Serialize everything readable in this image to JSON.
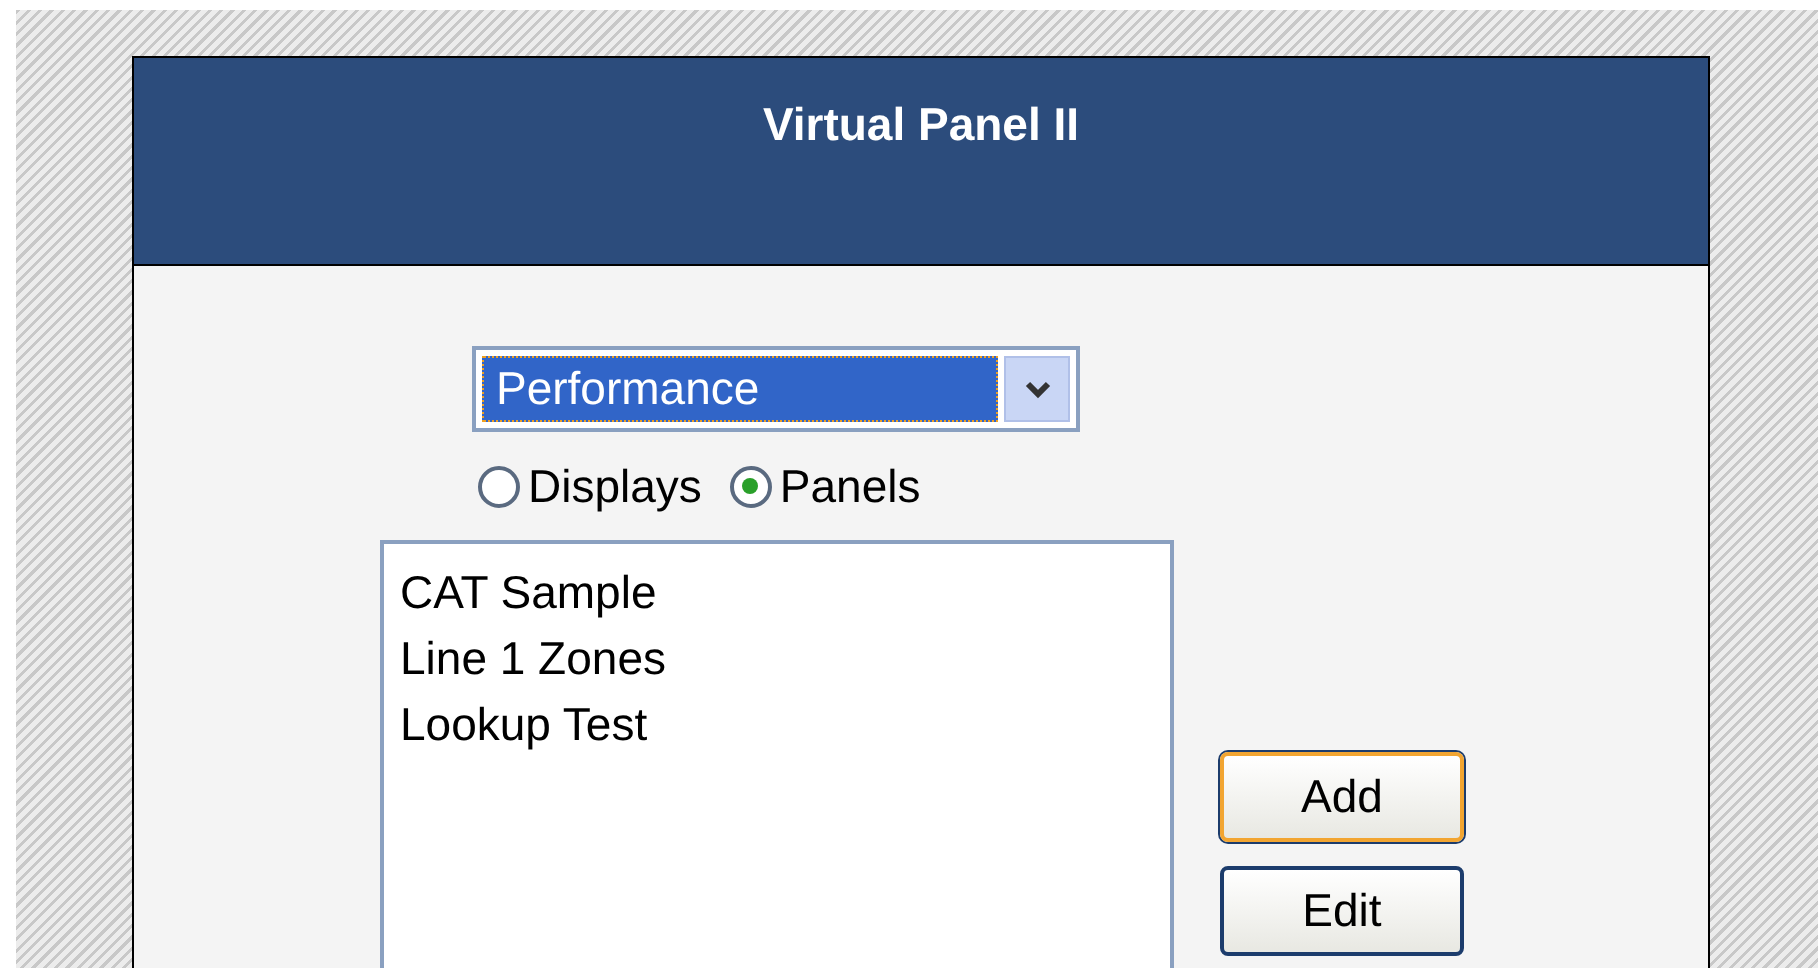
{
  "window": {
    "title": "Virtual Panel II"
  },
  "select": {
    "value": "Performance",
    "focused": true
  },
  "view_options": [
    {
      "label": "Displays",
      "selected": false
    },
    {
      "label": "Panels",
      "selected": true
    }
  ],
  "list": {
    "items": [
      {
        "label": "CAT Sample",
        "selected": false
      },
      {
        "label": "Line 1 Zones",
        "selected": false
      },
      {
        "label": "Lookup Test",
        "selected": false
      }
    ]
  },
  "buttons": [
    {
      "label": "Add",
      "focused": true
    },
    {
      "label": "Edit",
      "focused": false
    }
  ]
}
